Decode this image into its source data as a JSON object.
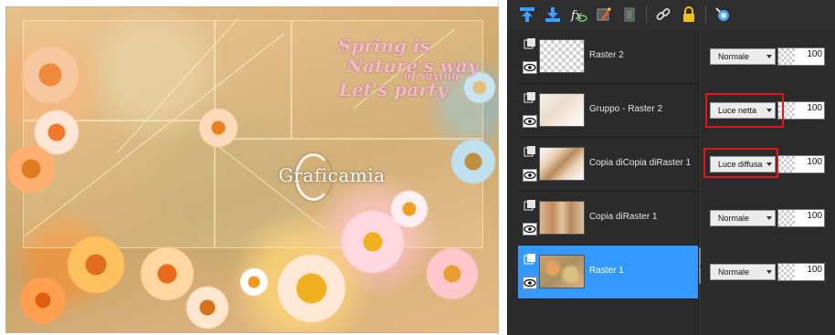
{
  "canvas": {
    "quote_line1": "Spring is",
    "quote_line2": "Nature's way",
    "quote_line2_small": "of saying",
    "quote_line3": "Let's party",
    "watermark": "Graficamia"
  },
  "toolbar": {
    "icons": [
      "move-layer-up-icon",
      "move-layer-down-icon",
      "new-layer-icon",
      "edit-mask-icon",
      "delete-layer-icon",
      "link-icon",
      "lock-icon",
      "visibility-toggle-icon"
    ]
  },
  "layers": [
    {
      "name": "Raster 2",
      "blend_mode": "Normale",
      "opacity": "100",
      "selected": false
    },
    {
      "name": "Gruppo - Raster 2",
      "blend_mode": "Luce netta",
      "opacity": "100",
      "selected": false
    },
    {
      "name": "Copia diCopia diRaster 1",
      "blend_mode": "Luce diffusa",
      "opacity": "100",
      "selected": false
    },
    {
      "name": "Copia diRaster 1",
      "blend_mode": "Normale",
      "opacity": "100",
      "selected": false
    },
    {
      "name": "Raster 1",
      "blend_mode": "Normale",
      "opacity": "100",
      "selected": true
    }
  ],
  "colors": {
    "palette_bg": "#2b2b2b",
    "selected_row": "#3399ff",
    "highlight_border": "#e01818"
  }
}
